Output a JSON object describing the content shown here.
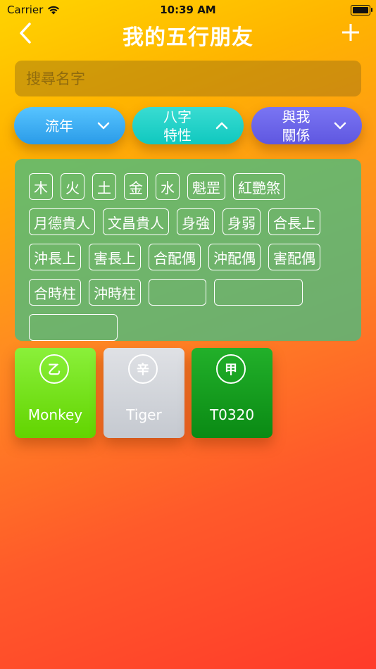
{
  "status": {
    "carrier": "Carrier",
    "time": "10:39 AM"
  },
  "nav": {
    "title": "我的五行朋友"
  },
  "search": {
    "placeholder": "搜尋名字"
  },
  "filters": [
    {
      "label": "流年",
      "chevron": "down"
    },
    {
      "label": "八字\n特性",
      "chevron": "up"
    },
    {
      "label": "與我\n關係",
      "chevron": "down"
    }
  ],
  "tags": [
    "木",
    "火",
    "土",
    "金",
    "水",
    "魁罡",
    "紅艷煞",
    "月德貴人",
    "文昌貴人",
    "身強",
    "身弱",
    "合長上",
    "沖長上",
    "害長上",
    "合配偶",
    "沖配偶",
    "害配偶",
    "合時柱",
    "沖時柱"
  ],
  "cards": [
    {
      "badge": "乙",
      "name": "Monkey",
      "color": "#72e01a"
    },
    {
      "badge": "辛",
      "name": "Tiger",
      "color": "#d3d6db"
    },
    {
      "badge": "甲",
      "name": "T0320",
      "color": "#149a1d"
    }
  ]
}
